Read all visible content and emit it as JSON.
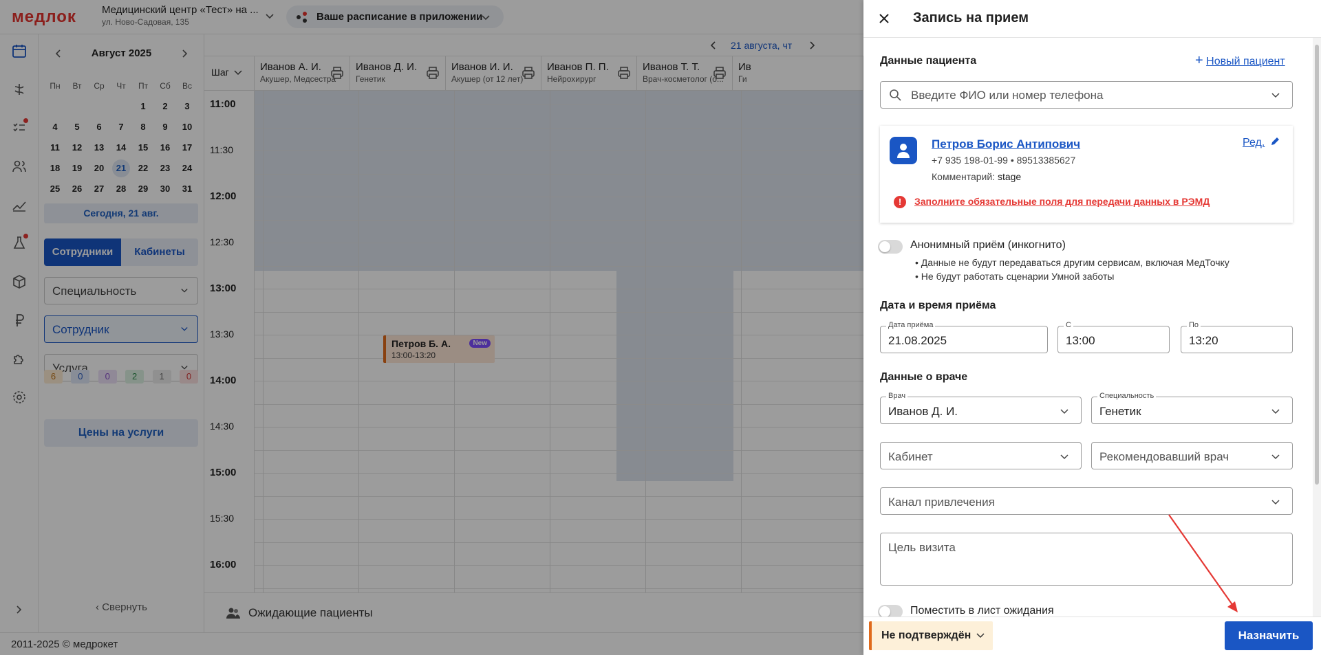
{
  "brand": {
    "logo": "медлок",
    "accent": "#1a56c4",
    "logo_color": "#e3342f"
  },
  "topbar": {
    "clinic_name": "Медицинский центр «Тест» на ...",
    "clinic_address": "ул. Ново-Садовая, 135",
    "app_pill": "Ваше расписание в приложении"
  },
  "nav_icons": [
    "calendar-icon",
    "medical-icon",
    "tasks-icon",
    "users-icon",
    "chart-icon",
    "flask-icon",
    "box-icon",
    "ruble-icon",
    "puzzle-icon",
    "gear-icon"
  ],
  "calendar": {
    "month": "Август 2025",
    "weekdays": [
      "Пн",
      "Вт",
      "Ср",
      "Чт",
      "Пт",
      "Сб",
      "Вс"
    ],
    "weeks": [
      [
        "",
        "",
        "",
        "",
        "1",
        "2",
        "3"
      ],
      [
        "4",
        "5",
        "6",
        "7",
        "8",
        "9",
        "10"
      ],
      [
        "11",
        "12",
        "13",
        "14",
        "15",
        "16",
        "17"
      ],
      [
        "18",
        "19",
        "20",
        "21",
        "22",
        "23",
        "24"
      ],
      [
        "25",
        "26",
        "27",
        "28",
        "29",
        "30",
        "31"
      ]
    ],
    "selected": "21",
    "today_button": "Сегодня, 21 авг."
  },
  "sidebar": {
    "tab_staff": "Сотрудники",
    "tab_rooms": "Кабинеты",
    "filter_specialty": "Специальность",
    "filter_employee": "Сотрудник",
    "filter_service": "Услуга",
    "counters": [
      {
        "v": "6",
        "bg": "#fdebd3",
        "fg": "#c0761c"
      },
      {
        "v": "0",
        "bg": "#dfe7f7",
        "fg": "#2f5fbf"
      },
      {
        "v": "0",
        "bg": "#ece1f7",
        "fg": "#8a4fc9"
      },
      {
        "v": "2",
        "bg": "#dcf0e2",
        "fg": "#2d8a4a"
      },
      {
        "v": "1",
        "bg": "#ececec",
        "fg": "#666666"
      },
      {
        "v": "0",
        "bg": "#fbe0e0",
        "fg": "#d23a3a"
      }
    ],
    "prices_button": "Цены на услуги",
    "collapse": "Свернуть"
  },
  "schedule": {
    "date_label": "21 августа, чт",
    "step_label": "Шаг",
    "columns": [
      {
        "name": "Иванов А. И.",
        "spec": "Акушер, Медсестра"
      },
      {
        "name": "Иванов Д. И.",
        "spec": "Генетик"
      },
      {
        "name": "Иванов И. И.",
        "spec": "Акушер (от 12 лет)"
      },
      {
        "name": "Иванов П. П.",
        "spec": "Нейрохирург"
      },
      {
        "name": "Иванов Т. Т.",
        "spec": "Врач-косметолог (о..."
      },
      {
        "name": "Ив",
        "spec": "Ги"
      }
    ],
    "times": [
      "11:00",
      "11:30",
      "12:00",
      "12:30",
      "13:00",
      "13:30",
      "14:00",
      "14:30",
      "15:00",
      "15:30",
      "16:00"
    ],
    "appointment": {
      "name": "Петров Б. А.",
      "time": "13:00-13:20",
      "badge": "New"
    },
    "waiting_patients": "Ожидающие пациенты"
  },
  "footer": {
    "copyright": "2011-2025 © медрокет"
  },
  "panel": {
    "title": "Запись на прием",
    "patient_section": "Данные пациента",
    "new_patient": "Новый пациент",
    "search_placeholder": "Введите ФИО или номер телефона",
    "patient": {
      "name": "Петров Борис Антипович",
      "phones": "+7 935 198-01-99 • 89513385627",
      "comment_label": "Комментарий:",
      "comment_value": "stage",
      "edit": "Ред.",
      "warning": "Заполните обязательные поля для передачи данных в РЭМД"
    },
    "anonymous": {
      "label": "Анонимный приём (инкогнито)",
      "notes": [
        "Данные не будут передаваться другим сервисам, включая МедТочку",
        "Не будут работать сценарии Умной заботы"
      ]
    },
    "datetime_section": "Дата и время приёма",
    "date_label": "Дата приёма",
    "date_value": "21.08.2025",
    "from_label": "С",
    "from_value": "13:00",
    "to_label": "По",
    "to_value": "13:20",
    "doctor_section": "Данные о враче",
    "doctor_label": "Врач",
    "doctor_value": "Иванов Д. И.",
    "specialty_label": "Специальность",
    "specialty_value": "Генетик",
    "room_placeholder": "Кабинет",
    "referrer_placeholder": "Рекомендовавший врач",
    "channel_placeholder": "Канал привлечения",
    "goal_placeholder": "Цель визита",
    "waitlist_label": "Поместить в лист ожидания",
    "status": "Не подтверждён",
    "assign_button": "Назначить"
  }
}
